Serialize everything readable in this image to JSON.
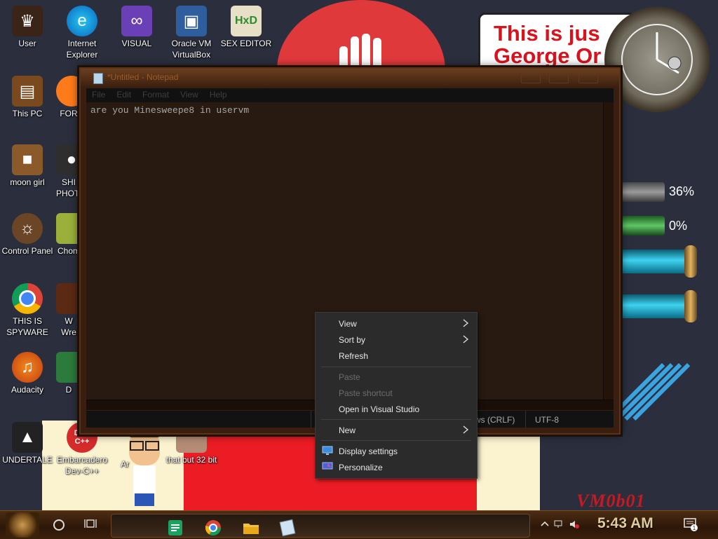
{
  "desktop": {
    "icons": [
      {
        "label": "User"
      },
      {
        "label": "Internet Explorer"
      },
      {
        "label": "VISUAL"
      },
      {
        "label": "Oracle VM VirtualBox"
      },
      {
        "label": "SEX EDITOR"
      },
      {
        "label": "This PC"
      },
      {
        "label": "FOR"
      },
      {
        "label": "moon girl"
      },
      {
        "label": "SHI PHOTO"
      },
      {
        "label": "Control Panel"
      },
      {
        "label": "Chom"
      },
      {
        "label": "THIS IS SPYWARE"
      },
      {
        "label": "W Wre"
      },
      {
        "label": "Audacity"
      },
      {
        "label": "D"
      },
      {
        "label": "UNDERTALE"
      },
      {
        "label": "Embarcadero Dev-C++"
      },
      {
        "label": "Ar"
      },
      {
        "label": "that but 32 bit"
      }
    ],
    "wallpaper": {
      "bubble_text_line1": "This is jus",
      "bubble_text_line2": "George Or",
      "vm_text": "VM0b01",
      "gauge1_pct": "36%",
      "gauge2_pct": "0%",
      "gauge1_level": 0.36,
      "gauge2_level": 0.0
    }
  },
  "notepad": {
    "title": "*Untitled - Notepad",
    "menu": [
      "File",
      "Edit",
      "Format",
      "View",
      "Help"
    ],
    "content": "are you Minesweepe8 in uservm",
    "status": {
      "line_ending": "ws (CRLF)",
      "encoding": "UTF-8"
    }
  },
  "context_menu": {
    "items": [
      {
        "label": "View",
        "submenu": true,
        "enabled": true
      },
      {
        "label": "Sort by",
        "submenu": true,
        "enabled": true
      },
      {
        "label": "Refresh",
        "submenu": false,
        "enabled": true
      },
      {
        "label": "Paste",
        "submenu": false,
        "enabled": false
      },
      {
        "label": "Paste shortcut",
        "submenu": false,
        "enabled": false
      },
      {
        "label": "Open in Visual Studio",
        "submenu": false,
        "enabled": true
      },
      {
        "label": "New",
        "submenu": true,
        "enabled": true
      },
      {
        "label": "Display settings",
        "submenu": false,
        "enabled": true,
        "icon": "display-icon"
      },
      {
        "label": "Personalize",
        "submenu": false,
        "enabled": true,
        "icon": "personalize-icon"
      }
    ]
  },
  "taskbar": {
    "clock": "5:43 AM",
    "notification_count": "1",
    "pinned": [
      "spreadsheet-icon",
      "chrome-icon",
      "file-explorer-icon",
      "notepad-icon"
    ]
  },
  "colors": {
    "accent_red": "#ec1c24",
    "notepad_bg": "#281a10",
    "menu_bg": "#2b2b2b",
    "clock_text": "#e0cc9a"
  }
}
